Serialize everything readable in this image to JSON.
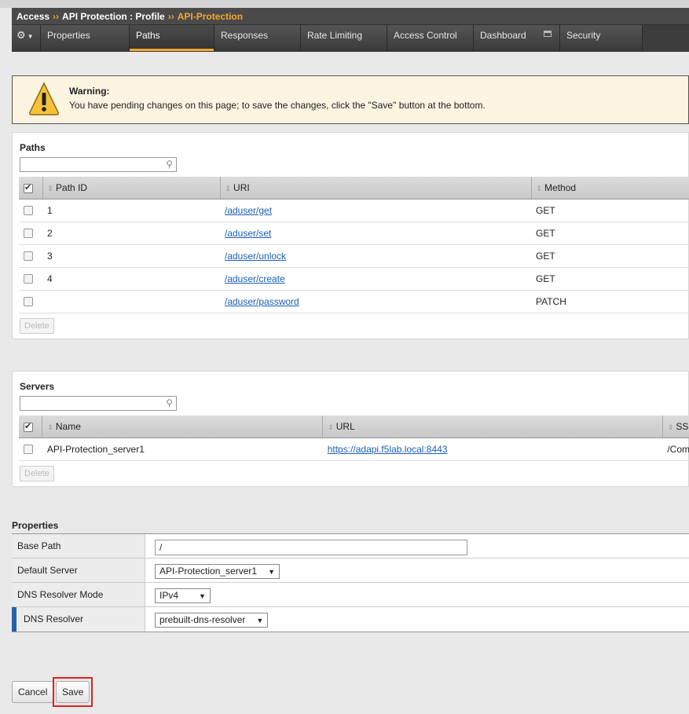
{
  "breadcrumb": {
    "part1": "Access",
    "part2": "API Protection : Profile",
    "current": "API-Protection",
    "sep": "››"
  },
  "tabs": [
    {
      "label": "Properties"
    },
    {
      "label": "Paths"
    },
    {
      "label": "Responses"
    },
    {
      "label": "Rate Limiting"
    },
    {
      "label": "Access Control"
    },
    {
      "label": "Dashboard"
    },
    {
      "label": "Security"
    }
  ],
  "warning": {
    "title": "Warning:",
    "text": "You have pending changes on this page; to save the changes, click the \"Save\" button at the bottom."
  },
  "paths": {
    "title": "Paths",
    "columns": [
      "Path ID",
      "URI",
      "Method"
    ],
    "rows": [
      {
        "id": "1",
        "uri": "/aduser/get",
        "method": "GET"
      },
      {
        "id": "2",
        "uri": "/aduser/set",
        "method": "GET"
      },
      {
        "id": "3",
        "uri": "/aduser/unlock",
        "method": "GET"
      },
      {
        "id": "4",
        "uri": "/aduser/create",
        "method": "GET"
      },
      {
        "id": "",
        "uri": "/aduser/password",
        "method": "PATCH"
      }
    ],
    "delete_label": "Delete"
  },
  "servers": {
    "title": "Servers",
    "columns": [
      "Name",
      "URL",
      "SS"
    ],
    "rows": [
      {
        "name": "API-Protection_server1",
        "url": "https://adapi.f5lab.local:8443",
        "ssl": "/Com"
      }
    ],
    "delete_label": "Delete"
  },
  "properties": {
    "title": "Properties",
    "base_path_label": "Base Path",
    "base_path_value": "/",
    "default_server_label": "Default Server",
    "default_server_value": "API-Protection_server1",
    "dns_mode_label": "DNS Resolver Mode",
    "dns_mode_value": "IPv4",
    "dns_resolver_label": "DNS Resolver",
    "dns_resolver_value": "prebuilt-dns-resolver"
  },
  "buttons": {
    "cancel": "Cancel",
    "save": "Save"
  },
  "colors": {
    "accent": "#f0a830",
    "link": "#1a5fb4",
    "highlight": "#e02020"
  }
}
